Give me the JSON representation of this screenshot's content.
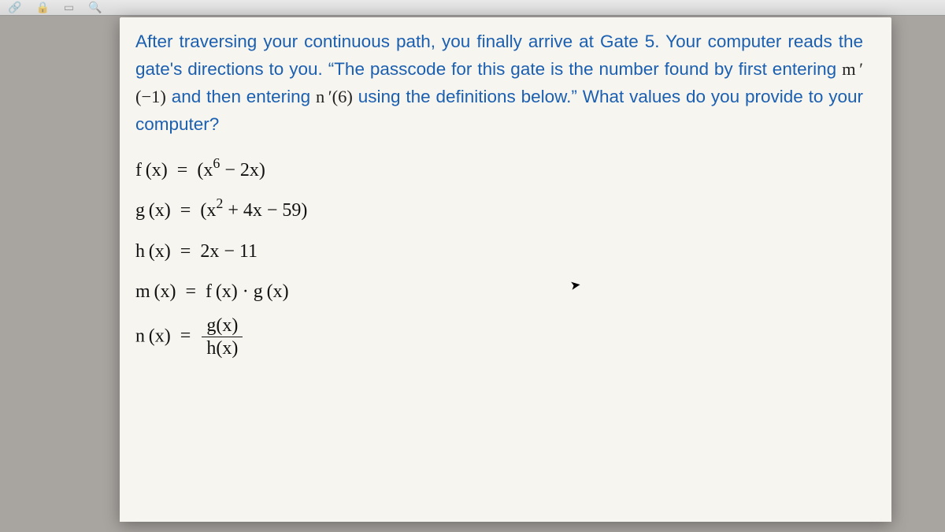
{
  "toolbar": {
    "icons": [
      "link",
      "lock",
      "tabs",
      "search"
    ]
  },
  "problem": {
    "p1a": "After traversing your continuous path, you finally arrive at Gate 5. Your computer reads the gate's directions to you. “The passcode for this gate is the number found by first entering ",
    "mprime": "m ′(−1)",
    "p1b": " and then entering ",
    "nprime": "n ′(6)",
    "p1c": " using the definitions below.” What values do you provide to your computer?"
  },
  "formulas": {
    "f_lhs": "f (x)",
    "f_rhs_a": "(x",
    "f_exp": "6",
    "f_rhs_b": " − 2x)",
    "g_lhs": "g (x)",
    "g_rhs_a": "(x",
    "g_exp": "2",
    "g_rhs_b": " + 4x − 59)",
    "h_lhs": "h (x)",
    "h_rhs": "2x − 11",
    "m_lhs": "m (x)",
    "m_rhs": "f (x) · g (x)",
    "n_lhs": "n (x)",
    "n_num": "g(x)",
    "n_den": "h(x)",
    "equals": "="
  }
}
